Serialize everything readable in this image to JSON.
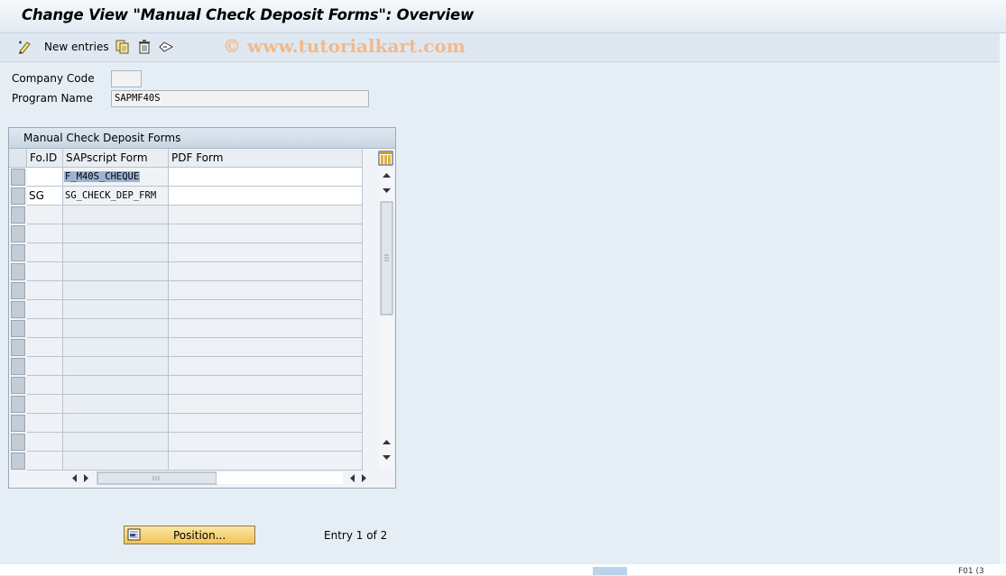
{
  "window": {
    "title": "Change View \"Manual Check Deposit Forms\": Overview"
  },
  "toolbar": {
    "new_entries_label": "New entries",
    "icons": [
      "new-entries-icon",
      "copy-icon",
      "delete-icon",
      "undo-change-icon"
    ],
    "watermark": "© www.tutorialkart.com"
  },
  "fields": {
    "company_code": {
      "label": "Company Code",
      "value": ""
    },
    "program_name": {
      "label": "Program Name",
      "value": "SAPMF40S"
    }
  },
  "table": {
    "title": "Manual Check Deposit Forms",
    "columns": [
      "Fo.ID",
      "SAPscript Form",
      "PDF Form"
    ],
    "rows": [
      {
        "foid": "",
        "sapscript": "F_M40S_CHEQUE",
        "pdf": ""
      },
      {
        "foid": "SG",
        "sapscript": "SG_CHECK_DEP_FRM",
        "pdf": ""
      }
    ],
    "column_settings_icon": "table-settings-icon"
  },
  "footer": {
    "position_button_label": "Position...",
    "entry_text": "Entry 1 of 2",
    "status_text": "F01 (3"
  },
  "colors": {
    "background": "#e6eef5",
    "button": "#f0c35a",
    "selected_cell": "#9cb3d3",
    "watermark": "#f2b98c"
  }
}
